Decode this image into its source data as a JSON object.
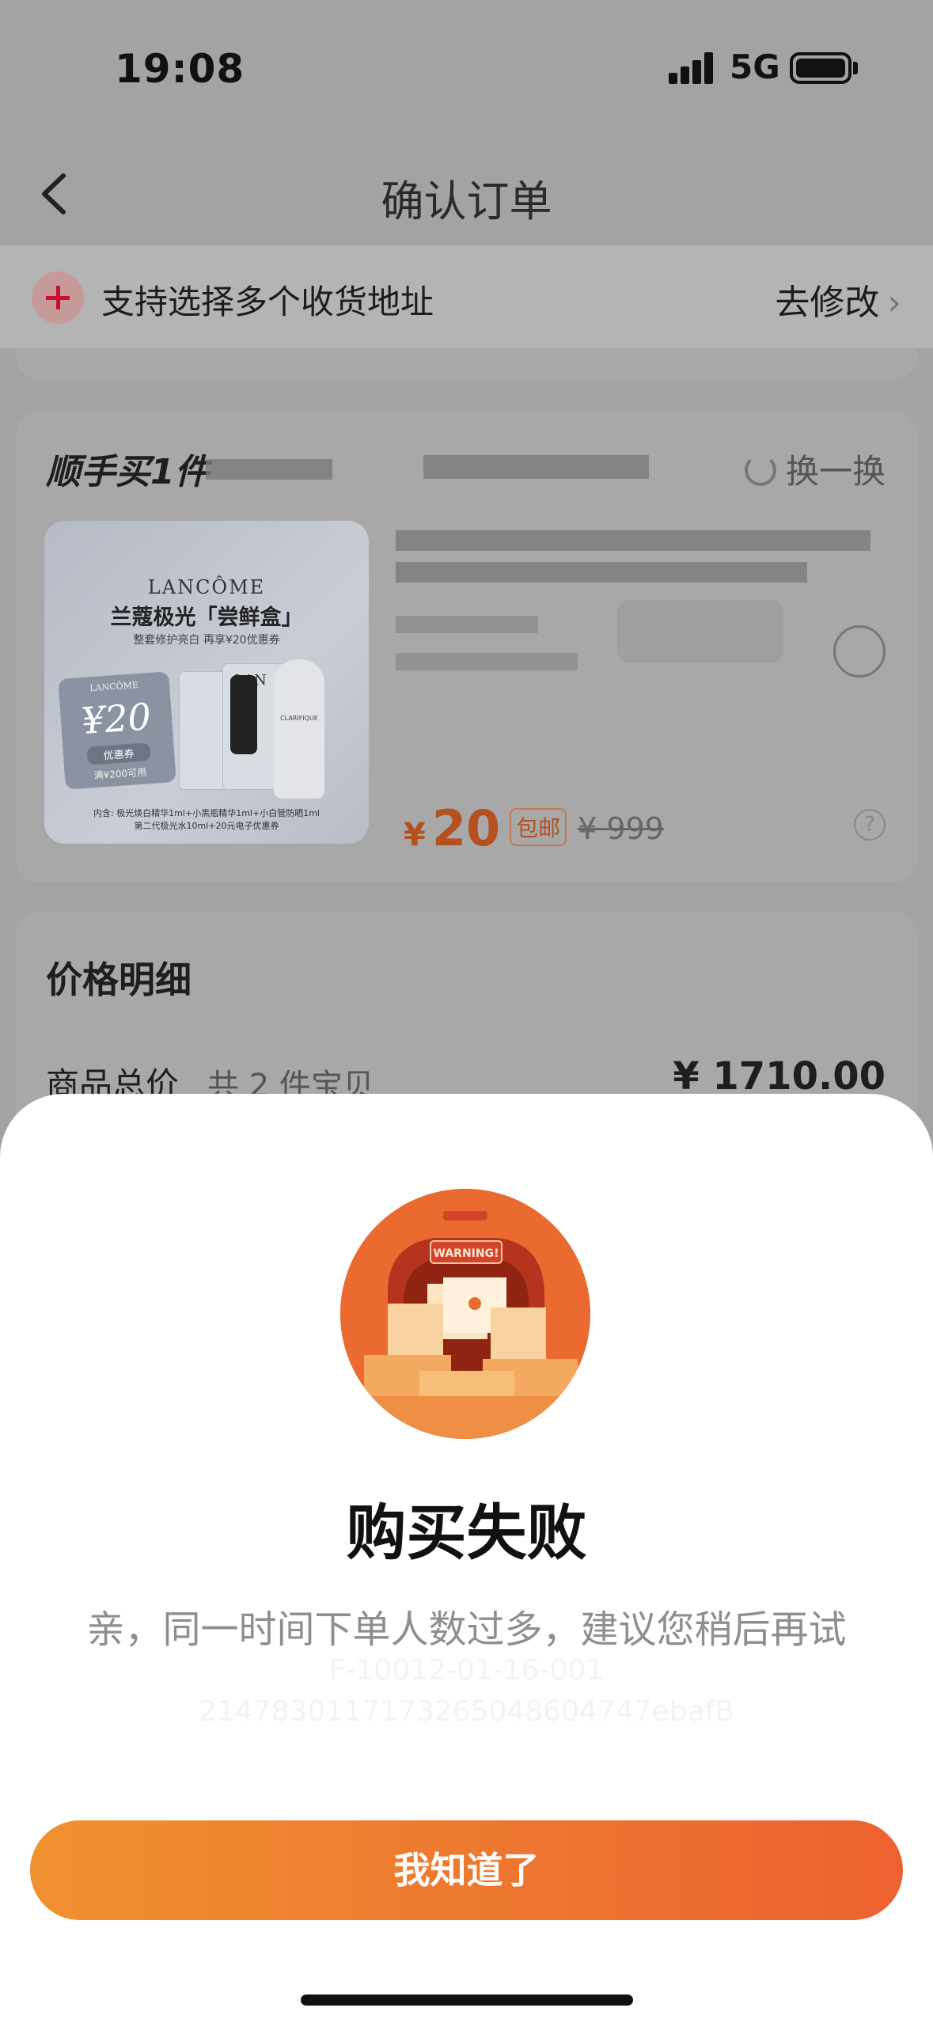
{
  "status_bar": {
    "time": "19:08",
    "network": "5G"
  },
  "nav": {
    "title": "确认订单"
  },
  "address": {
    "text": "支持选择多个收货地址",
    "action": "去修改",
    "chevron": "›"
  },
  "addon": {
    "title": "顺手买1件",
    "swap_label": "换一换",
    "image": {
      "brand": "LANCÔME",
      "title": "兰蔻极光「尝鲜盒」",
      "subtitle": "整套修护亮白 再享¥20优惠券",
      "coupon_brand": "LANCÔME",
      "coupon_value": "¥20",
      "coupon_label": "优惠券",
      "coupon_condition": "满¥200可用",
      "box_brand": "LAN",
      "bottle_label": "CLARIFIQUE",
      "footer_line1": "内含: 极光焕白精华1ml+小黑瓶精华1ml+小白管防晒1ml",
      "footer_line2": "第二代极光水10ml+20元电子优惠券"
    },
    "price_symbol": "¥",
    "price": "20",
    "shipping_tag": "包邮",
    "original_price": "¥ 999",
    "help": "?"
  },
  "price_detail": {
    "title": "价格明细",
    "total_label": "商品总价",
    "total_count": "共 2 件宝贝",
    "total_value": "¥ 1710.00"
  },
  "modal": {
    "illustration_sign": "WARNING!",
    "title": "购买失败",
    "message": "亲，同一时间下单人数过多，建议您稍后再试",
    "error_code": "F-10012-01-16-001",
    "trace_id": "2147830117173265048604747ebafB",
    "button_label": "我知道了"
  },
  "colors": {
    "accent_start": "#f0912f",
    "accent_end": "#ec6130",
    "price": "#e6541a"
  }
}
